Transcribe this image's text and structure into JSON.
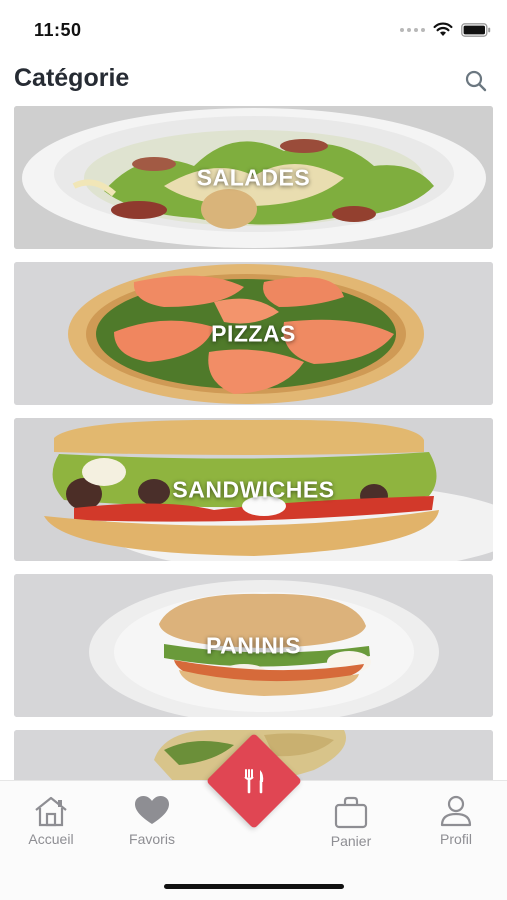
{
  "status_bar": {
    "time": "11:50",
    "icons": [
      "signal-dots-icon",
      "wifi-icon",
      "battery-icon"
    ]
  },
  "header": {
    "title": "Catégorie",
    "search_icon": "search-icon"
  },
  "categories": [
    {
      "label": "SALADES"
    },
    {
      "label": "PIZZAS"
    },
    {
      "label": "SANDWICHES"
    },
    {
      "label": "PANINIS"
    },
    {
      "label": ""
    }
  ],
  "tab_bar": {
    "tabs": [
      {
        "label": "Accueil",
        "icon": "home-icon"
      },
      {
        "label": "Favoris",
        "icon": "heart-icon"
      },
      {
        "label": "",
        "icon": "fork-knife-icon"
      },
      {
        "label": "Panier",
        "icon": "bag-icon"
      },
      {
        "label": "Profil",
        "icon": "user-icon"
      }
    ]
  },
  "colors": {
    "accent": "#e04653",
    "tab_inactive": "#8e8e93",
    "title": "#262b33"
  }
}
